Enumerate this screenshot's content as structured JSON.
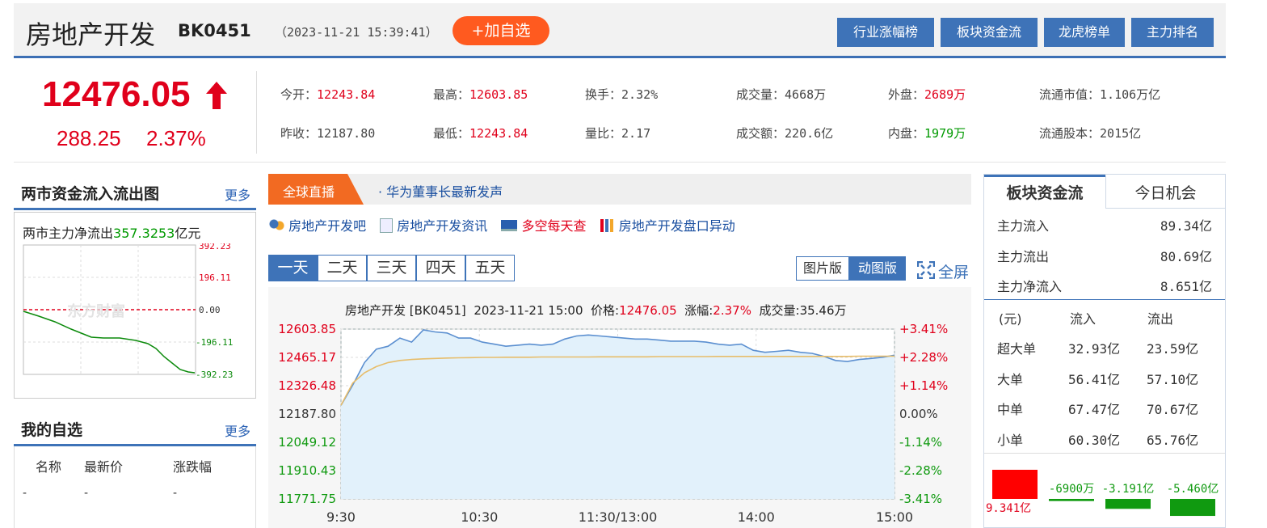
{
  "header": {
    "title": "房地产开发",
    "code": "BK0451",
    "timestamp": "（2023-11-21 15:39:41）",
    "add_label": "+加自选",
    "links": [
      "行业涨幅榜",
      "板块资金流",
      "龙虎榜单",
      "主力排名"
    ]
  },
  "quote": {
    "price": "12476.05",
    "change": "288.25",
    "change_pct": "2.37%",
    "fields": [
      {
        "label": "今开：",
        "value": "12243.84",
        "color": "red"
      },
      {
        "label": "最高：",
        "value": "12603.85",
        "color": "red"
      },
      {
        "label": "换手：",
        "value": "2.32%",
        "color": "plain"
      },
      {
        "label": "成交量：",
        "value": "4668万",
        "color": "plain"
      },
      {
        "label": "外盘：",
        "value": "2689万",
        "color": "red"
      },
      {
        "label": "流通市值：",
        "value": "1.106万亿",
        "color": "plain"
      },
      {
        "label": "昨收：",
        "value": "12187.80",
        "color": "plain"
      },
      {
        "label": "最低：",
        "value": "12243.84",
        "color": "red"
      },
      {
        "label": "量比：",
        "value": "2.17",
        "color": "plain"
      },
      {
        "label": "成交额：",
        "value": "220.6亿",
        "color": "plain"
      },
      {
        "label": "内盘：",
        "value": "1979万",
        "color": "green"
      },
      {
        "label": "流通股本：",
        "value": "2015亿",
        "color": "plain"
      }
    ]
  },
  "left": {
    "flow_title": "两市资金流入流出图",
    "more": "更多",
    "mini_label": "两市主力净流出",
    "mini_value": "357.3253",
    "mini_unit": "亿元",
    "mini_ticks": [
      "392.23",
      "196.11",
      "0.00",
      "-196.11",
      "-392.23"
    ],
    "watch_title": "我的自选",
    "watch_more": "更多",
    "watch_cols": [
      "名称",
      "最新价",
      "涨跌幅"
    ],
    "watch_row": [
      "-",
      "-",
      "-"
    ]
  },
  "center": {
    "live_label": "全球直播",
    "headline": "华为董事长最新发声",
    "links": [
      "房地产开发吧",
      "房地产开发资讯",
      "多空每天查",
      "房地产开发盘口异动"
    ],
    "tabs": [
      "一天",
      "二天",
      "三天",
      "四天",
      "五天"
    ],
    "view": [
      "图片版",
      "动图版"
    ],
    "fullscreen": "全屏",
    "chart_header": {
      "name": "房地产开发 [BK0451]",
      "datetime": "2023-11-21 15:00",
      "price_label": "价格:",
      "price": "12476.05",
      "chg_label": "涨幅:",
      "chg": "2.37%",
      "vol_label": "成交量:",
      "vol": "35.46万"
    },
    "watermark": "东方财富"
  },
  "chart_data": {
    "type": "line",
    "y_ticks": [
      "12603.85",
      "12465.17",
      "12326.48",
      "12187.80",
      "12049.12",
      "11910.43",
      "11771.75"
    ],
    "y_pct_ticks": [
      "+3.41%",
      "+2.28%",
      "+1.14%",
      "0.00%",
      "-1.14%",
      "-2.28%",
      "-3.41%"
    ],
    "x_ticks": [
      "9:30",
      "10:30",
      "11:30/13:00",
      "14:00",
      "15:00"
    ],
    "ylim": [
      11771.75,
      12603.85
    ],
    "series": [
      {
        "values": [
          12230,
          12330,
          12440,
          12505,
          12520,
          12560,
          12540,
          12600,
          12590,
          12585,
          12560,
          12560,
          12540,
          12530,
          12520,
          12525,
          12530,
          12525,
          12530,
          12555,
          12570,
          12575,
          12570,
          12565,
          12560,
          12555,
          12555,
          12550,
          12545,
          12545,
          12545,
          12540,
          12530,
          12525,
          12530,
          12500,
          12490,
          12495,
          12500,
          12490,
          12485,
          12470,
          12450,
          12445,
          12455,
          12460,
          12466,
          12476
        ],
        "color": "#5b8fd0"
      },
      {
        "values": [
          12230,
          12340,
          12390,
          12420,
          12440,
          12450,
          12455,
          12458,
          12460,
          12462,
          12463,
          12464,
          12465,
          12465,
          12466,
          12466,
          12466,
          12467,
          12467,
          12467,
          12467,
          12467,
          12468,
          12468,
          12468,
          12468,
          12468,
          12469,
          12469,
          12469,
          12469,
          12469,
          12470,
          12470,
          12470,
          12470,
          12470,
          12470,
          12470,
          12470,
          12470,
          12470,
          12470,
          12470,
          12471,
          12471,
          12471,
          12471
        ],
        "color": "#e7bd6a"
      }
    ]
  },
  "right": {
    "tabs": [
      "板块资金流",
      "今日机会"
    ],
    "summary": [
      {
        "label": "主力流入",
        "value": "89.34亿",
        "color": "red"
      },
      {
        "label": "主力流出",
        "value": "80.69亿",
        "color": "green"
      },
      {
        "label": "主力净流入",
        "value": "8.651亿",
        "color": "red"
      }
    ],
    "table_head": [
      "(元)",
      "流入",
      "流出"
    ],
    "rows": [
      {
        "name": "超大单",
        "in": "32.93亿",
        "out": "23.59亿"
      },
      {
        "name": "大单",
        "in": "56.41亿",
        "out": "57.10亿"
      },
      {
        "name": "中单",
        "in": "67.47亿",
        "out": "70.67亿"
      },
      {
        "name": "小单",
        "in": "60.30亿",
        "out": "65.76亿"
      }
    ],
    "bars": [
      {
        "label": "9.341亿",
        "value": 9.341
      },
      {
        "label": "-6900万",
        "value": -0.69
      },
      {
        "label": "-3.191亿",
        "value": -3.191
      },
      {
        "label": "-5.460亿",
        "value": -5.46
      }
    ]
  }
}
